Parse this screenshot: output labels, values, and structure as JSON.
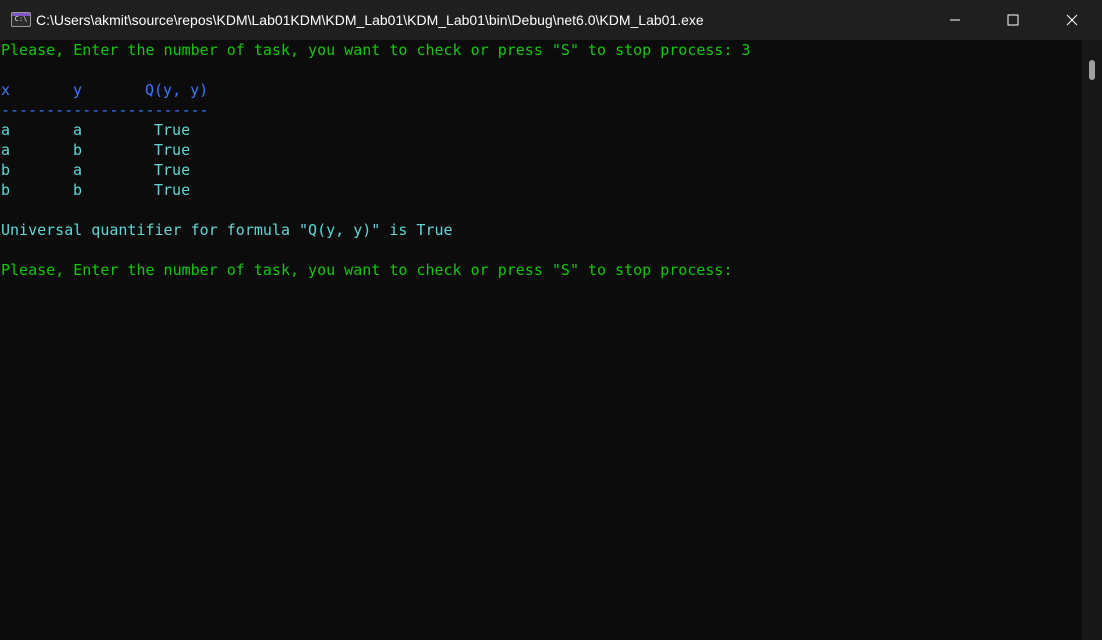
{
  "window": {
    "title": "C:\\Users\\akmit\\source\\repos\\KDM\\Lab01KDM\\KDM_Lab01\\KDM_Lab01\\bin\\Debug\\net6.0\\KDM_Lab01.exe",
    "icon": "C:\\",
    "controls": [
      "minimize-icon",
      "maximize-icon",
      "close-icon"
    ]
  },
  "colors": {
    "prompt": "#16c60c",
    "header": "#3b78ff",
    "output": "#61d6d6",
    "background": "#0c0c0c"
  },
  "console": {
    "prompt1": "Please, Enter the number of task, you want to check or press \"S\" to stop process: 3",
    "table": {
      "headers": [
        "x",
        "y",
        "Q(y, y)"
      ],
      "separator": "-----------------------",
      "rows": [
        [
          "a",
          "a",
          "True"
        ],
        [
          "a",
          "b",
          "True"
        ],
        [
          "b",
          "a",
          "True"
        ],
        [
          "b",
          "b",
          "True"
        ]
      ]
    },
    "result": "Universal quantifier for formula \"Q(y, y)\" is True",
    "prompt2": "Please, Enter the number of task, you want to check or press \"S\" to stop process:"
  }
}
